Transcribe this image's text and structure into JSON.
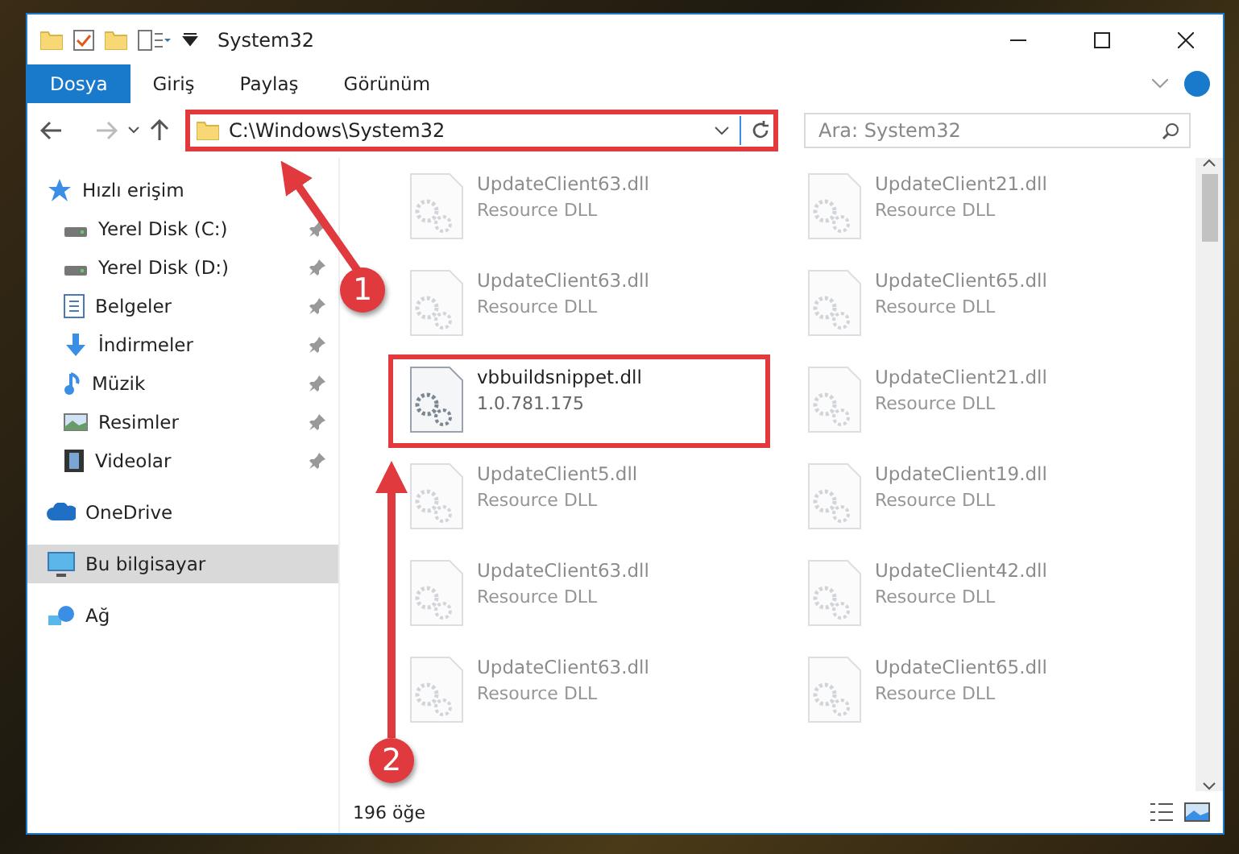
{
  "window": {
    "title": "System32"
  },
  "ribbon_tabs": [
    {
      "label": "Dosya",
      "selected": true
    },
    {
      "label": "Giriş",
      "selected": false
    },
    {
      "label": "Paylaş",
      "selected": false
    },
    {
      "label": "Görünüm",
      "selected": false
    }
  ],
  "address_bar": {
    "path": "C:\\Windows\\System32",
    "highlighted": true
  },
  "search": {
    "placeholder": "Ara: System32"
  },
  "sidebar": {
    "items": [
      {
        "label": "Hızlı erişim",
        "kind": "star",
        "selected": false,
        "children": [
          {
            "label": "Yerel Disk (C:)",
            "kind": "drive",
            "pinned": true,
            "selected": false
          },
          {
            "label": "Yerel Disk (D:)",
            "kind": "drive",
            "pinned": true,
            "selected": false
          },
          {
            "label": "Belgeler",
            "kind": "document",
            "pinned": true,
            "selected": false
          },
          {
            "label": "İndirmeler",
            "kind": "download",
            "pinned": true,
            "selected": false
          },
          {
            "label": "Müzik",
            "kind": "music",
            "pinned": true,
            "selected": false
          },
          {
            "label": "Resimler",
            "kind": "pictures",
            "pinned": true,
            "selected": false
          },
          {
            "label": "Videolar",
            "kind": "videos",
            "pinned": true,
            "selected": false
          }
        ]
      },
      {
        "label": "OneDrive",
        "kind": "cloud",
        "selected": false
      },
      {
        "label": "Bu bilgisayar",
        "kind": "computer",
        "selected": true
      },
      {
        "label": "Ağ",
        "kind": "network",
        "selected": false
      }
    ]
  },
  "files": [
    {
      "name": "UpdateClient63.dll",
      "detail": "Resource DLL",
      "blurred": true,
      "highlighted": false
    },
    {
      "name": "UpdateClient21.dll",
      "detail": "Resource DLL",
      "blurred": true,
      "highlighted": false
    },
    {
      "name": "UpdateClient63.dll",
      "detail": "Resource DLL",
      "blurred": true,
      "highlighted": false
    },
    {
      "name": "UpdateClient65.dll",
      "detail": "Resource DLL",
      "blurred": true,
      "highlighted": false
    },
    {
      "name": "vbbuildsnippet.dll",
      "detail": "1.0.781.175",
      "blurred": false,
      "highlighted": true
    },
    {
      "name": "UpdateClient21.dll",
      "detail": "Resource DLL",
      "blurred": true,
      "highlighted": false
    },
    {
      "name": "UpdateClient5.dll",
      "detail": "Resource DLL",
      "blurred": true,
      "highlighted": false
    },
    {
      "name": "UpdateClient19.dll",
      "detail": "Resource DLL",
      "blurred": true,
      "highlighted": false
    },
    {
      "name": "UpdateClient63.dll",
      "detail": "Resource DLL",
      "blurred": true,
      "highlighted": false
    },
    {
      "name": "UpdateClient42.dll",
      "detail": "Resource DLL",
      "blurred": true,
      "highlighted": false
    },
    {
      "name": "UpdateClient63.dll",
      "detail": "Resource DLL",
      "blurred": true,
      "highlighted": false
    },
    {
      "name": "UpdateClient65.dll",
      "detail": "Resource DLL",
      "blurred": true,
      "highlighted": false
    }
  ],
  "status_bar": {
    "item_count": "196 öğe"
  },
  "callouts": [
    {
      "number": "1"
    },
    {
      "number": "2"
    }
  ]
}
